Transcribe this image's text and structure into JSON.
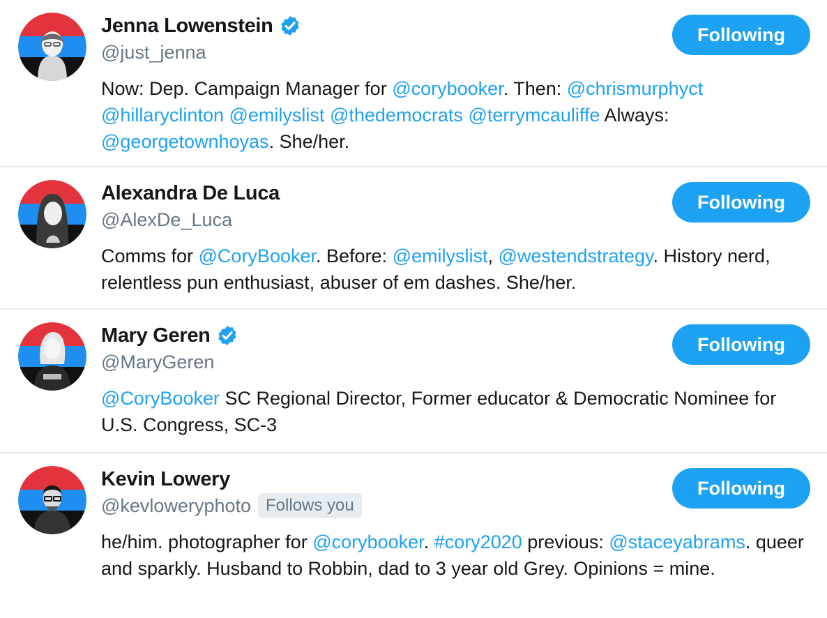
{
  "accent_color": "#1da1f2",
  "users": [
    {
      "name": "Jenna Lowenstein",
      "verified": true,
      "handle": "@just_jenna",
      "follows_you": false,
      "follow_label": "Following",
      "bio": [
        {
          "text": "Now: Dep. Campaign Manager for ",
          "link": false
        },
        {
          "text": "@corybooker",
          "link": true
        },
        {
          "text": ". Then: ",
          "link": false
        },
        {
          "text": "@chrismurphyct",
          "link": true
        },
        {
          "text": " ",
          "link": false
        },
        {
          "text": "@hillaryclinton",
          "link": true
        },
        {
          "text": " ",
          "link": false
        },
        {
          "text": "@emilyslist",
          "link": true
        },
        {
          "text": " ",
          "link": false
        },
        {
          "text": "@thedemocrats",
          "link": true
        },
        {
          "text": " ",
          "link": false
        },
        {
          "text": "@terrymcauliffe",
          "link": true
        },
        {
          "text": " Always: ",
          "link": false
        },
        {
          "text": "@georgetownhoyas",
          "link": true
        },
        {
          "text": ". She/her.",
          "link": false
        }
      ]
    },
    {
      "name": "Alexandra De Luca",
      "verified": false,
      "handle": "@AlexDe_Luca",
      "follows_you": false,
      "follow_label": "Following",
      "bio": [
        {
          "text": "Comms for ",
          "link": false
        },
        {
          "text": "@CoryBooker",
          "link": true
        },
        {
          "text": ". Before: ",
          "link": false
        },
        {
          "text": "@emilyslist",
          "link": true
        },
        {
          "text": ", ",
          "link": false
        },
        {
          "text": "@westendstrategy",
          "link": true
        },
        {
          "text": ". History nerd, relentless pun enthusiast, abuser of em dashes. She/her.",
          "link": false
        }
      ]
    },
    {
      "name": "Mary Geren",
      "verified": true,
      "handle": "@MaryGeren",
      "follows_you": false,
      "follow_label": "Following",
      "bio": [
        {
          "text": "@CoryBooker",
          "link": true
        },
        {
          "text": " SC Regional Director, Former educator & Democratic Nominee for U.S. Congress, SC-3",
          "link": false
        }
      ]
    },
    {
      "name": "Kevin Lowery",
      "verified": false,
      "handle": "@kevloweryphoto",
      "follows_you": true,
      "follows_you_label": "Follows you",
      "follow_label": "Following",
      "bio": [
        {
          "text": "he/him. photographer for ",
          "link": false
        },
        {
          "text": "@corybooker",
          "link": true
        },
        {
          "text": ". ",
          "link": false
        },
        {
          "text": "#cory2020",
          "link": true
        },
        {
          "text": " previous: ",
          "link": false
        },
        {
          "text": "@staceyabrams",
          "link": true
        },
        {
          "text": ". queer and sparkly. Husband to Robbin, dad to 3 year old Grey. Opinions = mine.",
          "link": false
        }
      ]
    }
  ]
}
